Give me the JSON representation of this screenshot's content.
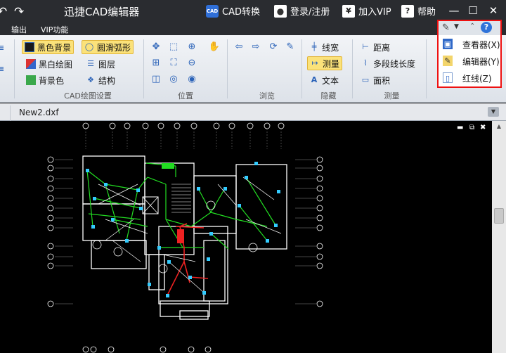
{
  "titlebar": {
    "app_title": "迅捷CAD编辑器",
    "cad_convert": "CAD转换",
    "cad_badge": "CAD",
    "login": "登录/注册",
    "vip_badge": "¥",
    "vip": "加入VIP",
    "help_badge": "?",
    "help": "帮助"
  },
  "menubar": {
    "items": [
      "输出",
      "VIP功能"
    ]
  },
  "ribbon": {
    "cad_settings": {
      "label": "CAD绘图设置",
      "black_bg": "黑色背景",
      "smooth_arc": "圆滑弧形",
      "bw_draw": "黑白绘图",
      "layers": "图层",
      "bg_color": "背景色",
      "structure": "结构"
    },
    "position": {
      "label": "位置"
    },
    "browse": {
      "label": "浏览"
    },
    "hide": {
      "label": "隐藏",
      "line_width": "线宽",
      "measure": "测量",
      "text": "文本"
    },
    "measure_group": {
      "label": "测量",
      "distance": "距离",
      "polyline_length": "多段线长度",
      "area": "面积"
    }
  },
  "dropdown": {
    "help_badge": "?",
    "items": [
      {
        "label": "查看器(X)"
      },
      {
        "label": "编辑器(Y)"
      },
      {
        "label": "红线(Z)"
      }
    ]
  },
  "tabs": [
    {
      "label": "New2.dxf"
    }
  ],
  "drawing": {
    "wall_color": "#ffffff",
    "wire_color": "#22dd22",
    "highlight_color": "#ee2222",
    "fixture_color": "#33ccff"
  }
}
